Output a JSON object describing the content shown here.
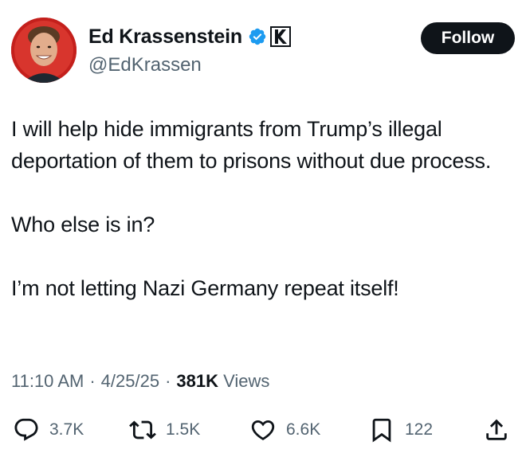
{
  "author": {
    "display_name": "Ed Krassenstein",
    "handle": "@EdKrassen",
    "verified_icon": "verified-badge-icon",
    "affiliate_icon": "k-affiliate-icon"
  },
  "follow_label": "Follow",
  "tweet": {
    "paragraphs": [
      "I will help hide immigrants from Trump’s illegal deportation of them to prisons without due process.",
      "Who else is in?",
      "I’m not letting Nazi Germany repeat itself!"
    ]
  },
  "meta": {
    "time": "11:10 AM",
    "separator": "·",
    "date": "4/25/25",
    "views_count": "381K",
    "views_label": "Views"
  },
  "actions": {
    "replies": "3.7K",
    "reposts": "1.5K",
    "likes": "6.6K",
    "bookmarks": "122"
  },
  "colors": {
    "text": "#0f1419",
    "secondary": "#536471",
    "verified": "#1d9bf0",
    "button_bg": "#0f1419",
    "button_text": "#ffffff",
    "avatar_bg": "#c4201c"
  }
}
